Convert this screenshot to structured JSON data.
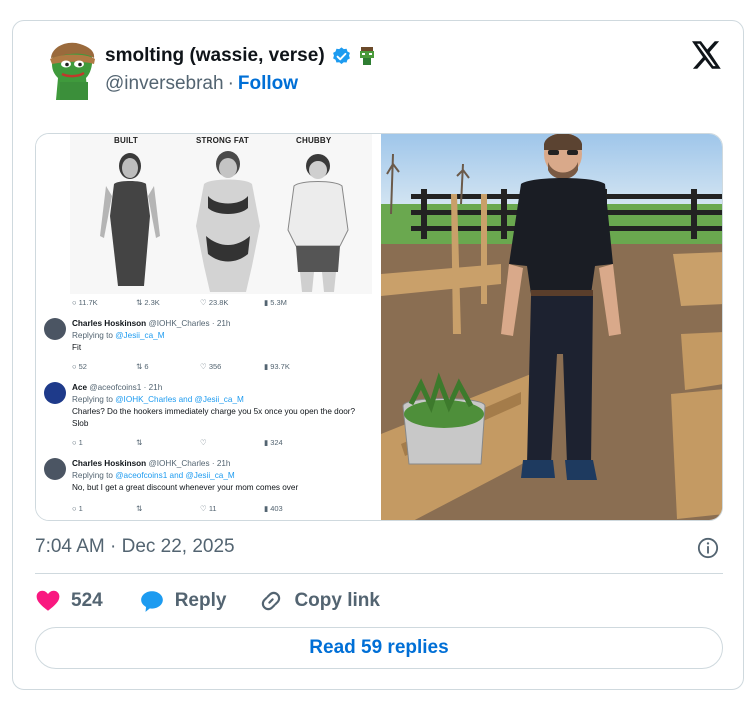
{
  "author": {
    "display_name": "smolting (wassie, verse)",
    "handle": "@inversebrah",
    "follow_label": "Follow"
  },
  "media": {
    "screenshot": {
      "labels": [
        "BUILT",
        "STRONG FAT",
        "CHUBBY"
      ],
      "stats_top": [
        "11.7K",
        "2.3K",
        "23.8K",
        "5.3M"
      ],
      "replies": [
        {
          "name": "Charles Hoskinson",
          "meta": "@IOHK_Charles · 21h",
          "replying": "Replying to ",
          "replying_to": "@Jesii_ca_M",
          "text": "Fit",
          "stats": [
            "52",
            "6",
            "356",
            "93.7K"
          ]
        },
        {
          "name": "Ace",
          "meta": "@aceofcoins1 · 21h",
          "replying": "Replying to ",
          "replying_to": "@IOHK_Charles and @Jesii_ca_M",
          "text": "Charles? Do the hookers immediately charge you 5x once you open the door?  Slob",
          "stats": [
            "1",
            "",
            "",
            "324"
          ]
        },
        {
          "name": "Charles Hoskinson",
          "meta": "@IOHK_Charles · 21h",
          "replying": "Replying to ",
          "replying_to": "@aceofcoins1 and @Jesii_ca_M",
          "text": "No, but I get a great discount whenever your mom comes over",
          "stats": [
            "1",
            "",
            "11",
            "403"
          ]
        }
      ]
    }
  },
  "footer": {
    "timestamp": "7:04 AM · Dec 22, 2025",
    "like_count": "524",
    "reply_label": "Reply",
    "copy_link_label": "Copy link",
    "read_replies_label": "Read 59 replies"
  },
  "colors": {
    "link_blue": "#006fd6",
    "like_pink": "#f91880",
    "reply_blue": "#1d9bf0",
    "muted": "#536471",
    "border": "#cfd9de"
  },
  "icons": [
    "verified-badge-icon",
    "x-logo-icon",
    "info-icon",
    "heart-icon",
    "reply-bubble-icon",
    "link-icon"
  ]
}
